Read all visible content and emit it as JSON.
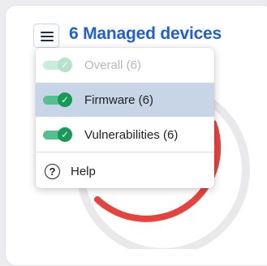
{
  "header": {
    "title": "6 Managed devices"
  },
  "menu": {
    "items": [
      {
        "label": "Overall (6)",
        "checked": true,
        "disabled": true
      },
      {
        "label": "Firmware (6)",
        "checked": true,
        "disabled": false,
        "highlighted": true
      },
      {
        "label": "Vulnerabilities (6)",
        "checked": true,
        "disabled": false
      }
    ],
    "help_label": "Help",
    "help_icon_glyph": "?"
  },
  "icons": {
    "menu": "hamburger-menu-icon",
    "check": "check-icon",
    "help": "question-circle-icon"
  },
  "colors": {
    "title": "#1f5fd8",
    "ring_red": "#e8423f",
    "ring_track": "#e9e9ec",
    "toggle_on": "#179a57",
    "highlight": "#c8d5e6"
  }
}
